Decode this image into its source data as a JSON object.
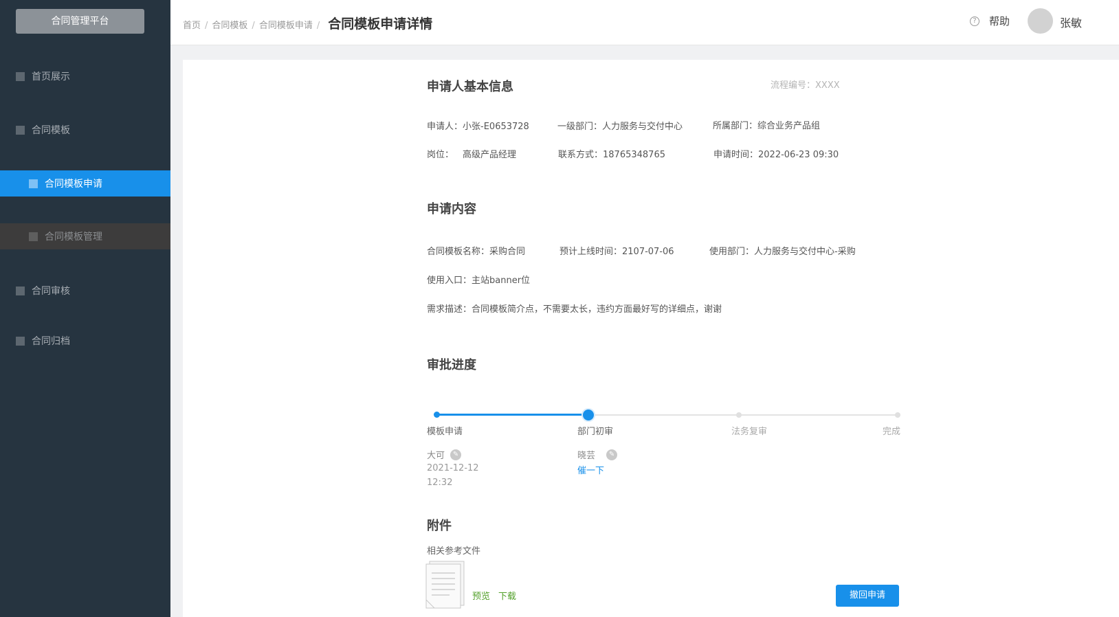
{
  "sidebar": {
    "brand": "合同管理平台",
    "items": [
      {
        "label": "首页展示"
      },
      {
        "label": "合同模板"
      },
      {
        "label": "合同模板申请"
      },
      {
        "label": "合同模板管理"
      },
      {
        "label": "合同审核"
      },
      {
        "label": "合同归档"
      }
    ]
  },
  "header": {
    "breadcrumbs": [
      "首页",
      "合同模板",
      "合同模板申请"
    ],
    "current": "合同模板申请详情",
    "help": "帮助",
    "help_icon": "?",
    "user": "张敏"
  },
  "applicant": {
    "title": "申请人基本信息",
    "flow_no_label": "流程编号：",
    "flow_no": "XXXX",
    "fields": [
      {
        "label": "申请人：",
        "value": "小张-E0653728"
      },
      {
        "label": "一级部门：",
        "value": "人力服务与交付中心"
      },
      {
        "label": "所属部门：",
        "value": "综合业务产品组"
      },
      {
        "label": "岗位：",
        "value": "高级产品经理"
      },
      {
        "label": "联系方式：",
        "value": "18765348765"
      },
      {
        "label": "申请时间：",
        "value": "2022-06-23 09:30"
      }
    ]
  },
  "content": {
    "title": "申请内容",
    "fields": [
      {
        "label": "合同模板名称：",
        "value": "采购合同"
      },
      {
        "label": "预计上线时间：",
        "value": "2107-07-06"
      },
      {
        "label": "使用部门：",
        "value": "人力服务与交付中心-采购"
      },
      {
        "label": "使用入口：",
        "value": "主站banner位"
      },
      {
        "label": "需求描述：",
        "value": "合同模板简介点，不需要太长，违约方面最好写的详细点，谢谢"
      }
    ]
  },
  "progress": {
    "title": "审批进度",
    "current_step": 2,
    "steps": [
      {
        "label": "模板申请",
        "person": "大可",
        "date": "2021-12-12",
        "time": "12:32"
      },
      {
        "label": "部门初审",
        "person": "晓芸",
        "action": "催一下"
      },
      {
        "label": "法务复审"
      },
      {
        "label": "完成"
      }
    ]
  },
  "attachment": {
    "title": "附件",
    "file_label": "相关参考文件",
    "preview": "预览",
    "download": "下载",
    "icon": "document-icon"
  },
  "actions": {
    "revoke": "撤回申请"
  },
  "colors": {
    "sidebar_bg": "#263440",
    "accent": "#1890ea",
    "link_green": "#52a02a"
  }
}
